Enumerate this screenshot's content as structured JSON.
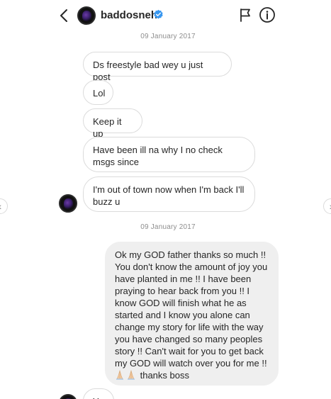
{
  "header": {
    "username": "baddosneh",
    "verified": true
  },
  "dates": [
    "09 January 2017",
    "09 January 2017"
  ],
  "messages_received": [
    "Ds freestyle bad wey u just post",
    "Lol",
    "Keep it up",
    "Have been ill na why I no check msgs since",
    "I'm out of town now when I'm back I'll buzz u"
  ],
  "sent_message": {
    "text": "Ok my GOD father thanks so much !! You don't know the amount of joy you have planted in me  !! I have been praying to hear back from you !! I know GOD will finish what he as started and I know you alone can change my story for life with the way you have changed so many peoples story !! Can't wait for you to get back my GOD  will watch over you for me !!",
    "tail": " thanks boss",
    "emoji_name": "folded-hands-icon"
  },
  "partial_reply": "Yo",
  "colors": {
    "accent_verified": "#3897f0",
    "sent_bubble": "#efefef",
    "border": "#dbdbdb",
    "muted_text": "#8e8e8e"
  }
}
